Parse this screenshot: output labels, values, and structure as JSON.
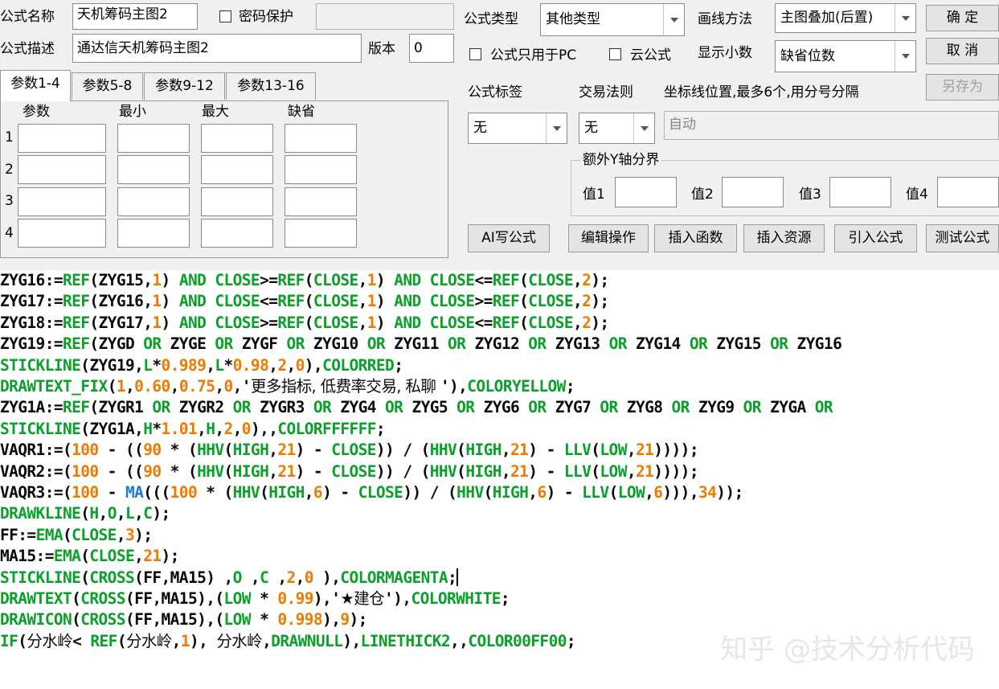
{
  "top": {
    "name_label": "公式名称",
    "name_value": "天机筹码主图2",
    "password_label": "密码保护",
    "desc_label": "公式描述",
    "desc_value": "通达信天机筹码主图2",
    "version_label": "版本",
    "version_value": "0"
  },
  "tabs": [
    "参数1-4",
    "参数5-8",
    "参数9-12",
    "参数13-16"
  ],
  "params": {
    "headers": [
      "参数",
      "最小",
      "最大",
      "缺省"
    ],
    "rows": [
      "1",
      "2",
      "3",
      "4"
    ]
  },
  "right": {
    "type_label": "公式类型",
    "type_value": "其他类型",
    "draw_label": "画线方法",
    "draw_value": "主图叠加(后置)",
    "confirm": "确  定",
    "cancel": "取  消",
    "save_as": "另存为",
    "pc_only_label": "公式只用于PC",
    "cloud_label": "云公式",
    "decimals_label": "显示小数",
    "decimals_value": "缺省位数",
    "tag_label": "公式标签",
    "rule_label": "交易法则",
    "axis_label": "坐标线位置,最多6个,用分号分隔",
    "tag_value": "无",
    "rule_value": "无",
    "axis_value": "自动",
    "extra_y_label": "额外Y轴分界",
    "v1": "值1",
    "v2": "值2",
    "v3": "值3",
    "v4": "值4"
  },
  "buttons": {
    "ai": "AI写公式",
    "edit": "编辑操作",
    "insert_func": "插入函数",
    "insert_res": "插入资源",
    "import": "引入公式",
    "test": "测试公式"
  },
  "code_lines": [
    [
      [
        "k",
        "ZYG16:="
      ],
      [
        "f",
        "REF"
      ],
      [
        "k",
        "(ZYG15,"
      ],
      [
        "n",
        "1"
      ],
      [
        "k",
        ") "
      ],
      [
        "f",
        "AND CLOSE"
      ],
      [
        "k",
        ">="
      ],
      [
        "f",
        "REF"
      ],
      [
        "k",
        "("
      ],
      [
        "f",
        "CLOSE"
      ],
      [
        "k",
        ","
      ],
      [
        "n",
        "1"
      ],
      [
        "k",
        ") "
      ],
      [
        "f",
        "AND CLOSE"
      ],
      [
        "k",
        "<="
      ],
      [
        "f",
        "REF"
      ],
      [
        "k",
        "("
      ],
      [
        "f",
        "CLOSE"
      ],
      [
        "k",
        ","
      ],
      [
        "n",
        "2"
      ],
      [
        "k",
        ");"
      ]
    ],
    [
      [
        "k",
        "ZYG17:="
      ],
      [
        "f",
        "REF"
      ],
      [
        "k",
        "(ZYG16,"
      ],
      [
        "n",
        "1"
      ],
      [
        "k",
        ") "
      ],
      [
        "f",
        "AND CLOSE"
      ],
      [
        "k",
        "<="
      ],
      [
        "f",
        "REF"
      ],
      [
        "k",
        "("
      ],
      [
        "f",
        "CLOSE"
      ],
      [
        "k",
        ","
      ],
      [
        "n",
        "1"
      ],
      [
        "k",
        ") "
      ],
      [
        "f",
        "AND CLOSE"
      ],
      [
        "k",
        ">="
      ],
      [
        "f",
        "REF"
      ],
      [
        "k",
        "("
      ],
      [
        "f",
        "CLOSE"
      ],
      [
        "k",
        ","
      ],
      [
        "n",
        "2"
      ],
      [
        "k",
        ");"
      ]
    ],
    [
      [
        "k",
        "ZYG18:="
      ],
      [
        "f",
        "REF"
      ],
      [
        "k",
        "(ZYG17,"
      ],
      [
        "n",
        "1"
      ],
      [
        "k",
        ") "
      ],
      [
        "f",
        "AND CLOSE"
      ],
      [
        "k",
        ">="
      ],
      [
        "f",
        "REF"
      ],
      [
        "k",
        "("
      ],
      [
        "f",
        "CLOSE"
      ],
      [
        "k",
        ","
      ],
      [
        "n",
        "1"
      ],
      [
        "k",
        ") "
      ],
      [
        "f",
        "AND CLOSE"
      ],
      [
        "k",
        "<="
      ],
      [
        "f",
        "REF"
      ],
      [
        "k",
        "("
      ],
      [
        "f",
        "CLOSE"
      ],
      [
        "k",
        ","
      ],
      [
        "n",
        "2"
      ],
      [
        "k",
        ");"
      ]
    ],
    [
      [
        "k",
        "ZYG19:="
      ],
      [
        "f",
        "REF"
      ],
      [
        "k",
        "(ZYGD "
      ],
      [
        "f",
        "OR"
      ],
      [
        "k",
        " ZYGE "
      ],
      [
        "f",
        "OR"
      ],
      [
        "k",
        " ZYGF "
      ],
      [
        "f",
        "OR"
      ],
      [
        "k",
        " ZYG10 "
      ],
      [
        "f",
        "OR"
      ],
      [
        "k",
        " ZYG11 "
      ],
      [
        "f",
        "OR"
      ],
      [
        "k",
        " ZYG12 "
      ],
      [
        "f",
        "OR"
      ],
      [
        "k",
        " ZYG13 "
      ],
      [
        "f",
        "OR"
      ],
      [
        "k",
        " ZYG14 "
      ],
      [
        "f",
        "OR"
      ],
      [
        "k",
        " ZYG15 "
      ],
      [
        "f",
        "OR"
      ],
      [
        "k",
        " ZYG16"
      ]
    ],
    [
      [
        "f",
        "STICKLINE"
      ],
      [
        "k",
        "(ZYG19,"
      ],
      [
        "f",
        "L"
      ],
      [
        "k",
        "*"
      ],
      [
        "n",
        "0.989"
      ],
      [
        "k",
        ","
      ],
      [
        "f",
        "L"
      ],
      [
        "k",
        "*"
      ],
      [
        "n",
        "0.98"
      ],
      [
        "k",
        ","
      ],
      [
        "n",
        "2"
      ],
      [
        "k",
        ","
      ],
      [
        "n",
        "0"
      ],
      [
        "k",
        "),"
      ],
      [
        "f",
        "COLORRED"
      ],
      [
        "k",
        ";"
      ]
    ],
    [
      [
        "f",
        "DRAWTEXT_FIX"
      ],
      [
        "k",
        "("
      ],
      [
        "n",
        "1"
      ],
      [
        "k",
        ","
      ],
      [
        "n",
        "0.60"
      ],
      [
        "k",
        ","
      ],
      [
        "n",
        "0.75"
      ],
      [
        "k",
        ","
      ],
      [
        "n",
        "0"
      ],
      [
        "k",
        ",'"
      ],
      [
        "c",
        "更多指标, 低费率交易, 私聊 "
      ],
      [
        "k",
        "'),"
      ],
      [
        "f",
        "COLORYELLOW"
      ],
      [
        "k",
        ";"
      ]
    ],
    [
      [
        "k",
        "ZYG1A:="
      ],
      [
        "f",
        "REF"
      ],
      [
        "k",
        "(ZYGR1 "
      ],
      [
        "f",
        "OR"
      ],
      [
        "k",
        " ZYGR2 "
      ],
      [
        "f",
        "OR"
      ],
      [
        "k",
        " ZYGR3 "
      ],
      [
        "f",
        "OR"
      ],
      [
        "k",
        " ZYG4 "
      ],
      [
        "f",
        "OR"
      ],
      [
        "k",
        " ZYG5 "
      ],
      [
        "f",
        "OR"
      ],
      [
        "k",
        " ZYG6 "
      ],
      [
        "f",
        "OR"
      ],
      [
        "k",
        " ZYG7 "
      ],
      [
        "f",
        "OR"
      ],
      [
        "k",
        " ZYG8 "
      ],
      [
        "f",
        "OR"
      ],
      [
        "k",
        " ZYG9 "
      ],
      [
        "f",
        "OR"
      ],
      [
        "k",
        " ZYGA "
      ],
      [
        "f",
        "OR"
      ]
    ],
    [
      [
        "f",
        "STICKLINE"
      ],
      [
        "k",
        "(ZYG1A,"
      ],
      [
        "f",
        "H"
      ],
      [
        "k",
        "*"
      ],
      [
        "n",
        "1.01"
      ],
      [
        "k",
        ","
      ],
      [
        "f",
        "H"
      ],
      [
        "k",
        ","
      ],
      [
        "n",
        "2"
      ],
      [
        "k",
        ","
      ],
      [
        "n",
        "0"
      ],
      [
        "k",
        "),,"
      ],
      [
        "f",
        "COLORFFFFFF"
      ],
      [
        "k",
        ";"
      ]
    ],
    [
      [
        "k",
        "VAQR1:=("
      ],
      [
        "n",
        "100"
      ],
      [
        "k",
        " - (("
      ],
      [
        "n",
        "90"
      ],
      [
        "k",
        " * ("
      ],
      [
        "f",
        "HHV"
      ],
      [
        "k",
        "("
      ],
      [
        "f",
        "HIGH"
      ],
      [
        "k",
        ","
      ],
      [
        "n",
        "21"
      ],
      [
        "k",
        ") - "
      ],
      [
        "f",
        "CLOSE"
      ],
      [
        "k",
        ")) / ("
      ],
      [
        "f",
        "HHV"
      ],
      [
        "k",
        "("
      ],
      [
        "f",
        "HIGH"
      ],
      [
        "k",
        ","
      ],
      [
        "n",
        "21"
      ],
      [
        "k",
        ") - "
      ],
      [
        "f",
        "LLV"
      ],
      [
        "k",
        "("
      ],
      [
        "f",
        "LOW"
      ],
      [
        "k",
        ","
      ],
      [
        "n",
        "21"
      ],
      [
        "k",
        "))));"
      ]
    ],
    [
      [
        "k",
        "VAQR2:=("
      ],
      [
        "n",
        "100"
      ],
      [
        "k",
        " - (("
      ],
      [
        "n",
        "90"
      ],
      [
        "k",
        " * ("
      ],
      [
        "f",
        "HHV"
      ],
      [
        "k",
        "("
      ],
      [
        "f",
        "HIGH"
      ],
      [
        "k",
        ","
      ],
      [
        "n",
        "21"
      ],
      [
        "k",
        ") - "
      ],
      [
        "f",
        "CLOSE"
      ],
      [
        "k",
        ")) / ("
      ],
      [
        "f",
        "HHV"
      ],
      [
        "k",
        "("
      ],
      [
        "f",
        "HIGH"
      ],
      [
        "k",
        ","
      ],
      [
        "n",
        "21"
      ],
      [
        "k",
        ") - "
      ],
      [
        "f",
        "LLV"
      ],
      [
        "k",
        "("
      ],
      [
        "f",
        "LOW"
      ],
      [
        "k",
        ","
      ],
      [
        "n",
        "21"
      ],
      [
        "k",
        "))));"
      ]
    ],
    [
      [
        "k",
        "VAQR3:=("
      ],
      [
        "n",
        "100"
      ],
      [
        "k",
        " - "
      ],
      [
        "b",
        "MA"
      ],
      [
        "k",
        "((("
      ],
      [
        "n",
        "100"
      ],
      [
        "k",
        " * ("
      ],
      [
        "f",
        "HHV"
      ],
      [
        "k",
        "("
      ],
      [
        "f",
        "HIGH"
      ],
      [
        "k",
        ","
      ],
      [
        "n",
        "6"
      ],
      [
        "k",
        ") - "
      ],
      [
        "f",
        "CLOSE"
      ],
      [
        "k",
        ")) / ("
      ],
      [
        "f",
        "HHV"
      ],
      [
        "k",
        "("
      ],
      [
        "f",
        "HIGH"
      ],
      [
        "k",
        ","
      ],
      [
        "n",
        "6"
      ],
      [
        "k",
        ") - "
      ],
      [
        "f",
        "LLV"
      ],
      [
        "k",
        "("
      ],
      [
        "f",
        "LOW"
      ],
      [
        "k",
        ","
      ],
      [
        "n",
        "6"
      ],
      [
        "k",
        ")))"
      ],
      [
        "k",
        ","
      ],
      [
        "n",
        "34"
      ],
      [
        "k",
        "));"
      ]
    ],
    [
      [
        "f",
        "DRAWKLINE"
      ],
      [
        "k",
        "("
      ],
      [
        "f",
        "H"
      ],
      [
        "k",
        ","
      ],
      [
        "f",
        "O"
      ],
      [
        "k",
        ","
      ],
      [
        "f",
        "L"
      ],
      [
        "k",
        ","
      ],
      [
        "f",
        "C"
      ],
      [
        "k",
        ");"
      ]
    ],
    [
      [
        "k",
        "FF:="
      ],
      [
        "f",
        "EMA"
      ],
      [
        "k",
        "("
      ],
      [
        "f",
        "CLOSE"
      ],
      [
        "k",
        ","
      ],
      [
        "n",
        "3"
      ],
      [
        "k",
        ");"
      ]
    ],
    [
      [
        "k",
        "MA15:="
      ],
      [
        "f",
        "EMA"
      ],
      [
        "k",
        "("
      ],
      [
        "f",
        "CLOSE"
      ],
      [
        "k",
        ","
      ],
      [
        "n",
        "21"
      ],
      [
        "k",
        ");"
      ]
    ],
    [
      [
        "f",
        "STICKLINE"
      ],
      [
        "k",
        "("
      ],
      [
        "f",
        "CROSS"
      ],
      [
        "k",
        "(FF,MA15) ,"
      ],
      [
        "f",
        "O"
      ],
      [
        "k",
        " ,"
      ],
      [
        "f",
        "C"
      ],
      [
        "k",
        " ,"
      ],
      [
        "n",
        "2"
      ],
      [
        "k",
        ","
      ],
      [
        "n",
        "0"
      ],
      [
        "k",
        " ),"
      ],
      [
        "f",
        "COLORMAGENTA"
      ],
      [
        "k",
        ";"
      ],
      [
        "caret",
        ""
      ]
    ],
    [
      [
        "f",
        "DRAWTEXT"
      ],
      [
        "k",
        "("
      ],
      [
        "f",
        "CROSS"
      ],
      [
        "k",
        "(FF,MA15),("
      ],
      [
        "f",
        "LOW"
      ],
      [
        "k",
        " * "
      ],
      [
        "n",
        "0.99"
      ],
      [
        "k",
        "),'"
      ],
      [
        "c",
        "★建仓"
      ],
      [
        "k",
        "'),"
      ],
      [
        "f",
        "COLORWHITE"
      ],
      [
        "k",
        ";"
      ]
    ],
    [
      [
        "f",
        "DRAWICON"
      ],
      [
        "k",
        "("
      ],
      [
        "f",
        "CROSS"
      ],
      [
        "k",
        "(FF,MA15),("
      ],
      [
        "f",
        "LOW"
      ],
      [
        "k",
        " * "
      ],
      [
        "n",
        "0.998"
      ],
      [
        "k",
        "),"
      ],
      [
        "n",
        "9"
      ],
      [
        "k",
        ");"
      ]
    ],
    [
      [
        "f",
        "IF"
      ],
      [
        "k",
        "("
      ],
      [
        "c",
        "分水岭"
      ],
      [
        "k",
        "< "
      ],
      [
        "f",
        "REF"
      ],
      [
        "k",
        "("
      ],
      [
        "c",
        "分水岭"
      ],
      [
        "k",
        ","
      ],
      [
        "n",
        "1"
      ],
      [
        "k",
        "), "
      ],
      [
        "c",
        "分水岭"
      ],
      [
        "k",
        ","
      ],
      [
        "f",
        "DRAWNULL"
      ],
      [
        "k",
        "),"
      ],
      [
        "f",
        "LINETHICK2"
      ],
      [
        "k",
        ",,"
      ],
      [
        "f",
        "COLOR00FF00"
      ],
      [
        "k",
        ";"
      ]
    ]
  ],
  "watermark": "知乎 @技术分析代码"
}
